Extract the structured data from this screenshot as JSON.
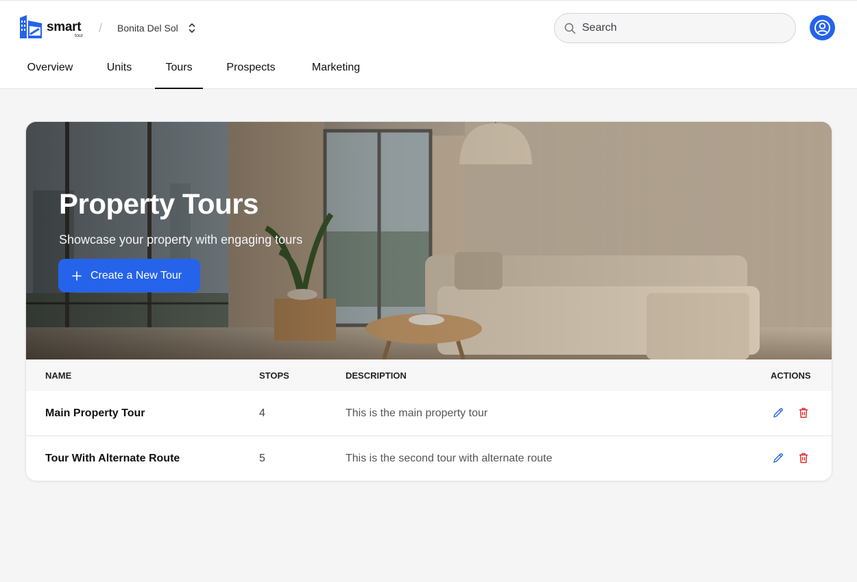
{
  "app": {
    "logo_word": "smart",
    "logo_sub": "tour"
  },
  "breadcrumb": {
    "separator": "/",
    "property_name": "Bonita Del Sol"
  },
  "search": {
    "placeholder": "Search"
  },
  "tabs": [
    {
      "label": "Overview"
    },
    {
      "label": "Units"
    },
    {
      "label": "Tours",
      "active": true
    },
    {
      "label": "Prospects"
    },
    {
      "label": "Marketing"
    }
  ],
  "hero": {
    "title": "Property Tours",
    "subtitle": "Showcase your property with engaging tours",
    "cta_label": "Create a New Tour"
  },
  "table": {
    "columns": {
      "name": "NAME",
      "stops": "STOPS",
      "description": "DESCRIPTION",
      "actions": "ACTIONS"
    },
    "rows": [
      {
        "name": "Main Property Tour",
        "stops": "4",
        "description": "This is the main property tour"
      },
      {
        "name": "Tour With Alternate Route",
        "stops": "5",
        "description": "This is the second tour with alternate route"
      }
    ]
  },
  "colors": {
    "accent": "#2563eb",
    "danger": "#dc2626",
    "edit": "#2563eb"
  },
  "icons": {
    "search": "search-icon",
    "avatar": "user-icon",
    "edit": "pencil-icon",
    "delete": "trash-icon",
    "chevron": "chevron-up-down-icon",
    "plus": "plus-icon"
  }
}
